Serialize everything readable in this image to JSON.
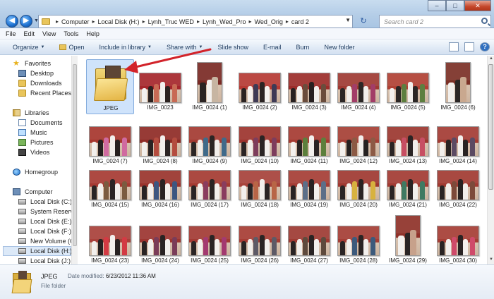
{
  "window": {
    "title_buttons": [
      "minimize",
      "maximize",
      "close"
    ]
  },
  "address": {
    "crumbs": [
      "Computer",
      "Local Disk (H:)",
      "Lynh_Truc WED",
      "Lynh_Wed_Pro",
      "Wed_Orig",
      "card 2"
    ]
  },
  "search": {
    "placeholder": "Search card 2"
  },
  "menubar": {
    "items": [
      "File",
      "Edit",
      "View",
      "Tools",
      "Help"
    ]
  },
  "toolbar": {
    "organize": "Organize",
    "open": "Open",
    "include": "Include in library",
    "share": "Share with",
    "slideshow": "Slide show",
    "email": "E-mail",
    "burn": "Burn",
    "newfolder": "New folder"
  },
  "navpane": {
    "favorites": "Favorites",
    "desktop": "Desktop",
    "downloads": "Downloads",
    "recent": "Recent Places",
    "libraries": "Libraries",
    "documents": "Documents",
    "music": "Music",
    "pictures": "Pictures",
    "videos": "Videos",
    "homegroup": "Homegroup",
    "computer": "Computer",
    "drives": [
      "Local Disk (C:)",
      "System Reserved",
      "Local Disk (E:)",
      "Local Disk (F:)",
      "New Volume (G:)",
      "Local Disk (H:)",
      "Local Disk (J:)"
    ]
  },
  "files": [
    {
      "name": "JPEG",
      "type": "folder"
    },
    {
      "name": "IMG_0023",
      "type": "land",
      "palette": [
        "#a5262c",
        "#f2f0ee",
        "#2b2220",
        "#c86a54"
      ]
    },
    {
      "name": "IMG_0024 (1)",
      "type": "port",
      "palette": [
        "#7a2a24",
        "#2a2322",
        "#f3f0ed",
        "#c7b5a2"
      ]
    },
    {
      "name": "IMG_0024 (2)",
      "type": "land",
      "palette": [
        "#b63a33",
        "#2a2322",
        "#f4f1ee",
        "#3e3a55"
      ]
    },
    {
      "name": "IMG_0024 (3)",
      "type": "land",
      "palette": [
        "#9c2d2a",
        "#272020",
        "#f2efec",
        "#6a4c3c"
      ]
    },
    {
      "name": "IMG_0024 (4)",
      "type": "land",
      "palette": [
        "#9f3a32",
        "#2b2625",
        "#f1eeeb",
        "#a23d68"
      ]
    },
    {
      "name": "IMG_0024 (5)",
      "type": "land",
      "palette": [
        "#b04134",
        "#f3f0ed",
        "#2b2625",
        "#5d7f3f"
      ]
    },
    {
      "name": "IMG_0024 (6)",
      "type": "port",
      "palette": [
        "#7b3026",
        "#f2efec",
        "#2b2625",
        "#c9a88f"
      ]
    },
    {
      "name": "IMG_0024 (7)",
      "type": "land",
      "palette": [
        "#a6362d",
        "#f2efec",
        "#262020",
        "#d06aa0"
      ]
    },
    {
      "name": "IMG_0024 (8)",
      "type": "land",
      "palette": [
        "#8f2b25",
        "#f2efec",
        "#2a2323",
        "#b44c3f"
      ]
    },
    {
      "name": "IMG_0024 (9)",
      "type": "land",
      "palette": [
        "#a33a31",
        "#2b2524",
        "#f1eeeb",
        "#3f6a8a"
      ]
    },
    {
      "name": "IMG_0024 (10)",
      "type": "land",
      "palette": [
        "#9d332d",
        "#2a2424",
        "#f2efec",
        "#7d3d5c"
      ]
    },
    {
      "name": "IMG_0024 (11)",
      "type": "land",
      "palette": [
        "#a53a31",
        "#f3f0ed",
        "#2a2424",
        "#5c7f3c"
      ]
    },
    {
      "name": "IMG_0024 (12)",
      "type": "land",
      "palette": [
        "#a53f35",
        "#f2efec",
        "#252121",
        "#8c5a45"
      ]
    },
    {
      "name": "IMG_0024 (13)",
      "type": "land",
      "palette": [
        "#9c372f",
        "#2a2424",
        "#f1eeeb",
        "#c74e63"
      ]
    },
    {
      "name": "IMG_0024 (14)",
      "type": "land",
      "palette": [
        "#a33b33",
        "#f2efec",
        "#292323",
        "#5b4a63"
      ]
    },
    {
      "name": "IMG_0024 (15)",
      "type": "land",
      "palette": [
        "#a63a32",
        "#2a2424",
        "#f2efec",
        "#7b5b40"
      ]
    },
    {
      "name": "IMG_0024 (16)",
      "type": "land",
      "palette": [
        "#9a332c",
        "#292323",
        "#f3f0ed",
        "#3d5680"
      ]
    },
    {
      "name": "IMG_0024 (17)",
      "type": "land",
      "palette": [
        "#a43a31",
        "#2a2424",
        "#f2efec",
        "#8a3d5e"
      ]
    },
    {
      "name": "IMG_0024 (18)",
      "type": "land",
      "palette": [
        "#a7423a",
        "#f2efec",
        "#2a2424",
        "#b86546"
      ]
    },
    {
      "name": "IMG_0024 (19)",
      "type": "land",
      "palette": [
        "#a53d35",
        "#292323",
        "#f3f0ed",
        "#5c6f88"
      ]
    },
    {
      "name": "IMG_0024 (20)",
      "type": "land",
      "palette": [
        "#9f3830",
        "#2a2424",
        "#f2efec",
        "#d7b23f"
      ]
    },
    {
      "name": "IMG_0024 (21)",
      "type": "land",
      "palette": [
        "#a23a32",
        "#2a2424",
        "#f2efec",
        "#3f7a62"
      ]
    },
    {
      "name": "IMG_0024 (22)",
      "type": "land",
      "palette": [
        "#a13a31",
        "#292323",
        "#f1eeeb",
        "#7c4a3a"
      ]
    },
    {
      "name": "IMG_0024 (23)",
      "type": "land",
      "palette": [
        "#a9403a",
        "#f2efec",
        "#272121",
        "#d33a43"
      ]
    },
    {
      "name": "IMG_0024 (24)",
      "type": "land",
      "palette": [
        "#9c3530",
        "#292323",
        "#f2efec",
        "#7a3c58"
      ]
    },
    {
      "name": "IMG_0024 (25)",
      "type": "land",
      "palette": [
        "#a23a33",
        "#2a2424",
        "#f3f0ed",
        "#a33a70"
      ]
    },
    {
      "name": "IMG_0024 (26)",
      "type": "land",
      "palette": [
        "#a63c34",
        "#2a2424",
        "#f2efec",
        "#5d5a66"
      ]
    },
    {
      "name": "IMG_0024 (27)",
      "type": "land",
      "palette": [
        "#9e3a32",
        "#292323",
        "#f2efec",
        "#5e4a3d"
      ]
    },
    {
      "name": "IMG_0024 (28)",
      "type": "land",
      "palette": [
        "#a43d35",
        "#2a2424",
        "#f2efec",
        "#3c5a7c"
      ]
    },
    {
      "name": "IMG_0024 (29)",
      "type": "port",
      "palette": [
        "#8f3129",
        "#f3f0ed",
        "#2a2424",
        "#c7a18b"
      ]
    },
    {
      "name": "IMG_0024 (30)",
      "type": "land",
      "palette": [
        "#a53d35",
        "#292323",
        "#f2efec",
        "#cf4a6a"
      ]
    },
    {
      "name": "",
      "type": "land",
      "palette": [
        "#a23a33",
        "#2a2424",
        "#f2efec",
        "#7a3d5e"
      ]
    },
    {
      "name": "",
      "type": "land",
      "palette": [
        "#9d3630",
        "#292323",
        "#f2efec",
        "#3f6a8a"
      ]
    },
    {
      "name": "",
      "type": "land",
      "palette": [
        "#a63c34",
        "#2a2424",
        "#f3f0ed",
        "#b86546"
      ]
    },
    {
      "name": "",
      "type": "land",
      "palette": [
        "#a23a33",
        "#2a2424",
        "#f2efec",
        "#5c7f3c"
      ]
    },
    {
      "name": "",
      "type": "land",
      "palette": [
        "#a53d35",
        "#292323",
        "#f2efec",
        "#8a3d5e"
      ]
    },
    {
      "name": "",
      "type": "land",
      "palette": [
        "#9f3830",
        "#2a2424",
        "#f2efec",
        "#d7b23f"
      ]
    },
    {
      "name": "",
      "type": "land",
      "palette": [
        "#a43d35",
        "#2a2424",
        "#f2efec",
        "#3c5a7c"
      ]
    },
    {
      "name": "",
      "type": "land",
      "palette": [
        "#a13a31",
        "#292323",
        "#f1eeeb",
        "#7c4a3a"
      ]
    }
  ],
  "details": {
    "name": "JPEG",
    "modified_label": "Date modified:",
    "modified_value": "6/23/2012 11:36 AM",
    "type": "File folder"
  },
  "annotation": {
    "arrow_color": "#d2232a"
  }
}
